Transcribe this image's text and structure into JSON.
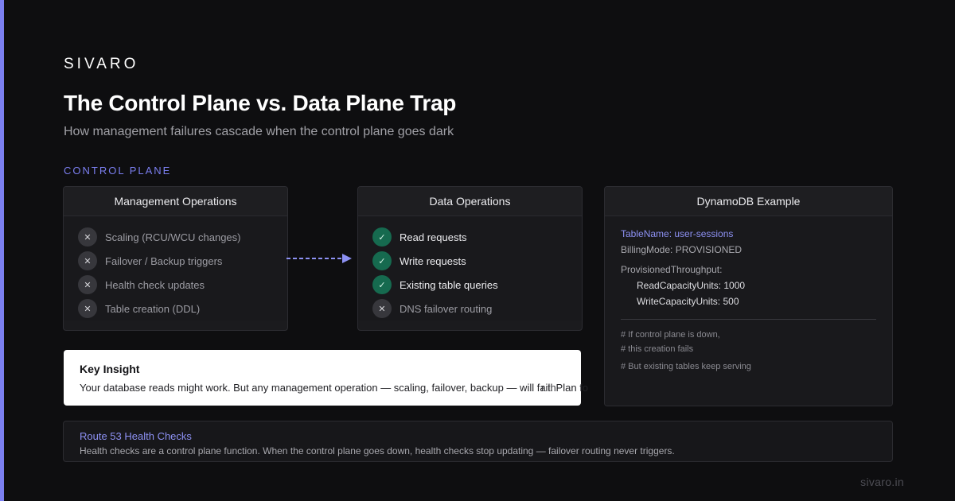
{
  "brand": {
    "logo": "SIVARO",
    "footer": "sivaro.in",
    "accent": "#7b7ff0"
  },
  "header": {
    "title": "The Control Plane vs. Data Plane Trap",
    "subtitle": "How management failures cascade when the control plane goes dark"
  },
  "section_label": "CONTROL PLANE",
  "management": {
    "title": "Management Operations",
    "items": [
      {
        "label": "Scaling (RCU/WCU changes)",
        "status": "fail",
        "icon": "x-icon"
      },
      {
        "label": "Failover / Backup triggers",
        "status": "fail",
        "icon": "x-icon"
      },
      {
        "label": "Health check updates",
        "status": "fail",
        "icon": "x-icon"
      },
      {
        "label": "Table creation (DDL)",
        "status": "fail",
        "icon": "x-icon"
      }
    ]
  },
  "data_ops": {
    "title": "Data Operations",
    "items": [
      {
        "label": "Read requests",
        "status": "ok",
        "icon": "check-icon"
      },
      {
        "label": "Write requests",
        "status": "ok",
        "icon": "check-icon"
      },
      {
        "label": "Existing table queries",
        "status": "ok",
        "icon": "check-icon"
      },
      {
        "label": "DNS failover routing",
        "status": "fail",
        "icon": "x-icon"
      }
    ]
  },
  "glyphs": {
    "check": "✓",
    "x": "✕"
  },
  "dynamo": {
    "title": "DynamoDB Example",
    "table_name": "TableName: user-sessions",
    "billing": "BillingMode: PROVISIONED",
    "throughput_label": "ProvisionedThroughput:",
    "read_capacity": "ReadCapacityUnits: 1000",
    "write_capacity": "WriteCapacityUnits: 500",
    "comment1": "# If control plane is down,",
    "comment2": "# this creation fails",
    "comment3": "# But existing tables keep serving"
  },
  "insight": {
    "title": "Key Insight",
    "text_visible": "Your database reads might work. But any management operation — scaling, failover, backup — will fail. Plan fo",
    "text_overflow": "r th"
  },
  "route53": {
    "title": "Route 53 Health Checks",
    "text": "Health checks are a control plane function. When the control plane goes down, health checks stop updating — failover routing never triggers."
  }
}
